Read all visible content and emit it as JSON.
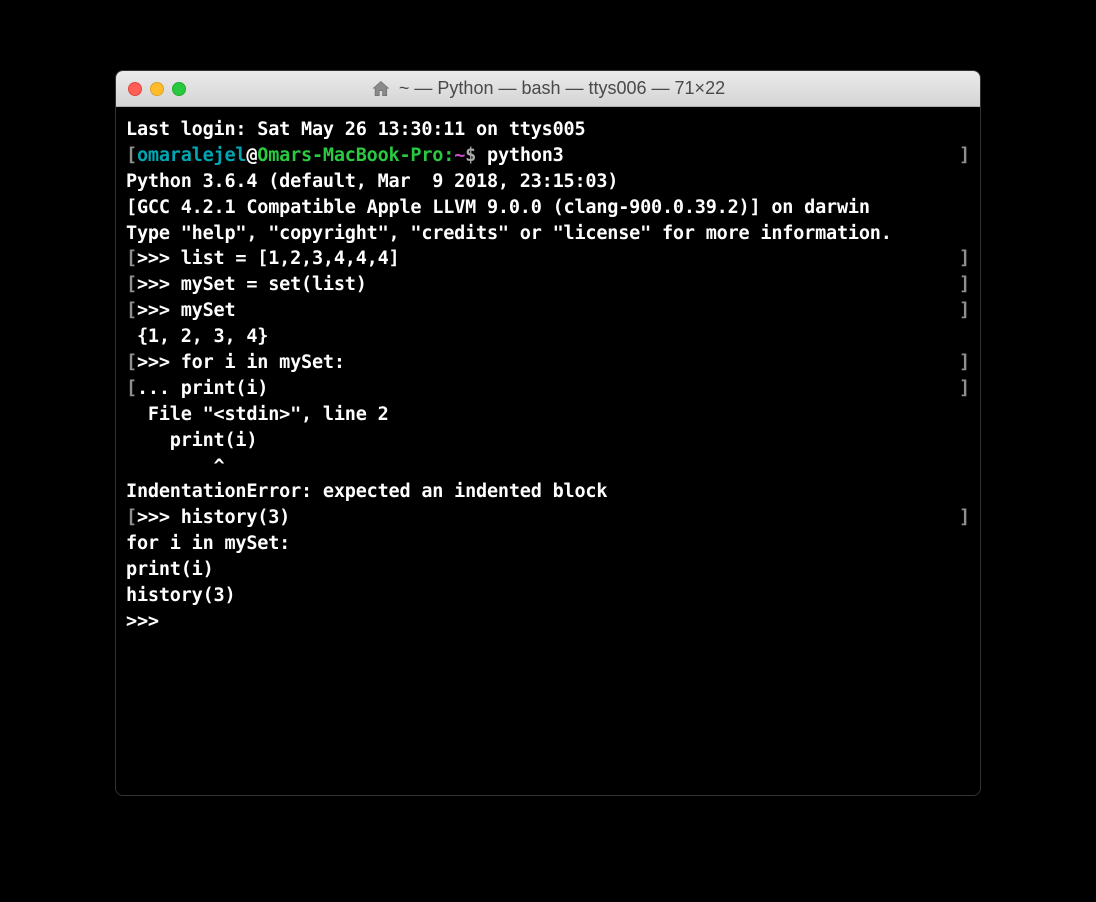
{
  "window": {
    "title": "~ — Python — bash — ttys006 — 71×22"
  },
  "colors": {
    "user": "#00a7b3",
    "host": "#29c940",
    "tilde": "#c94fc9",
    "bracket": "#8e8e8e"
  },
  "prompt": {
    "user": "omaralejel",
    "at": "@",
    "host": "Omars-MacBook-Pro:",
    "tilde": "~",
    "dollar": "$",
    "command": "python3",
    "open_bracket": "[",
    "close_bracket": "]"
  },
  "terminal": {
    "lastLogin": "Last login: Sat May 26 13:30:11 on ttys005",
    "pythonVersion": "Python 3.6.4 (default, Mar  9 2018, 23:15:03) ",
    "gccLine": "[GCC 4.2.1 Compatible Apple LLVM 9.0.0 (clang-900.0.39.2)] on darwin",
    "helpLine": "Type \"help\", \"copyright\", \"credits\" or \"license\" for more information.",
    "l1_prompt": ">>> ",
    "l1_text": "list = [1,2,3,4,4,4]",
    "l2_prompt": ">>> ",
    "l2_text": "mySet = set(list)",
    "l3_prompt": ">>> ",
    "l3_text": "mySet",
    "l4": "{1, 2, 3, 4}",
    "l5_prompt": ">>> ",
    "l5_text": "for i in mySet:",
    "l6_prompt": "... ",
    "l6_text": "print(i)",
    "l7": "  File \"<stdin>\", line 2",
    "l8": "    print(i)",
    "l9": "        ^",
    "l10": "IndentationError: expected an indented block",
    "l11_prompt": ">>> ",
    "l11_text": "history(3)",
    "l12": "for i in mySet:",
    "l13": "print(i)",
    "l14": "history(3)",
    "l15_prompt": ">>> "
  }
}
